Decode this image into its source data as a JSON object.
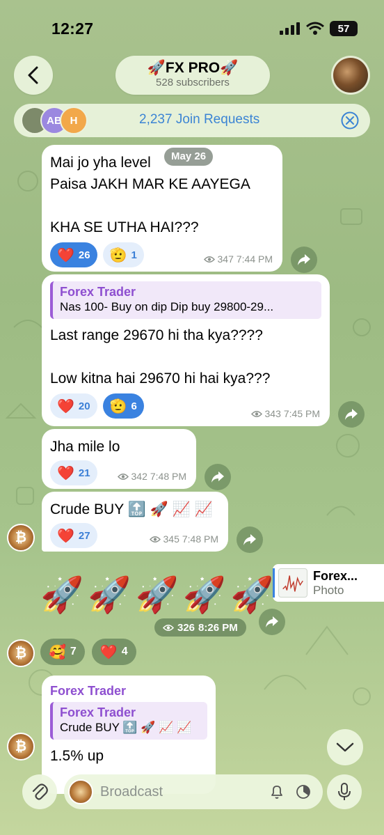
{
  "status_bar": {
    "time": "12:27",
    "battery": "57"
  },
  "header": {
    "channel_name": "🚀FX PRO🚀",
    "subscribers": "528 subscribers"
  },
  "join_requests": {
    "label": "2,237 Join Requests",
    "avatars": [
      "AB",
      "H"
    ]
  },
  "date_pill": "May 26",
  "messages": [
    {
      "text": "Mai jo yha level\nPaisa JAKH MAR KE AAYEGA\n\nKHA SE UTHA HAI???",
      "reactions": [
        {
          "emoji": "❤️",
          "count": "26",
          "active": true
        },
        {
          "emoji": "🫡",
          "count": "1",
          "active": false
        }
      ],
      "views": "347",
      "time": "7:44 PM"
    },
    {
      "reply_author": "Forex Trader",
      "reply_text": "Nas 100- Buy on dip Dip buy 29800-29...",
      "text": "Last range 29670 hi tha kya????\n\nLow kitna hai 29670 hi hai kya???",
      "reactions": [
        {
          "emoji": "❤️",
          "count": "20",
          "active": false
        },
        {
          "emoji": "🫡",
          "count": "6",
          "active": true
        }
      ],
      "views": "343",
      "time": "7:45 PM"
    },
    {
      "text": "Jha mile lo",
      "reactions": [
        {
          "emoji": "❤️",
          "count": "21",
          "active": false
        }
      ],
      "views": "342",
      "time": "7:48 PM"
    },
    {
      "text": "Crude BUY 🔝 🚀 📈 📈",
      "reactions": [
        {
          "emoji": "❤️",
          "count": "27",
          "active": false
        }
      ],
      "views": "345",
      "time": "7:48 PM"
    },
    {
      "sticker": "🚀🚀🚀🚀🚀",
      "views": "326",
      "time": "8:26 PM",
      "photo_ref_title": "Forex...",
      "photo_ref_sub": "Photo",
      "reactions": [
        {
          "emoji": "🥰",
          "count": "7"
        },
        {
          "emoji": "❤️",
          "count": "4"
        }
      ]
    },
    {
      "author": "Forex Trader",
      "reply_author": "Forex Trader",
      "reply_text": "Crude BUY 🔝 🚀 📈 📈",
      "text": "1.5% up"
    }
  ],
  "composer": {
    "placeholder": "Broadcast"
  },
  "colors": {
    "accent": "#3a82e0",
    "reply_purple": "#8e4fd0",
    "bubble": "#ffffff"
  }
}
